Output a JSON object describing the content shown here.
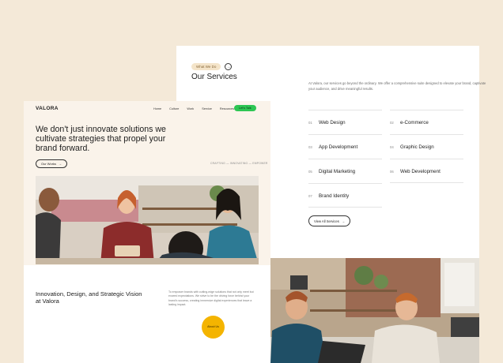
{
  "services": {
    "badge": "What We Do",
    "title": "Our Services",
    "description": "At Valora, our services go beyond the ordinary. We offer a comprehensive suite designed to elevate your brand, captivate your audience, and drive meaningful results.",
    "items": [
      {
        "num": "01",
        "label": "Web Design"
      },
      {
        "num": "02",
        "label": "e-Commerce"
      },
      {
        "num": "03",
        "label": "App Development"
      },
      {
        "num": "04",
        "label": "Graphic Design"
      },
      {
        "num": "05",
        "label": "Digital Marketing"
      },
      {
        "num": "06",
        "label": "Web Development"
      },
      {
        "num": "07",
        "label": "Brand Identity"
      }
    ],
    "view_all": "View All Services"
  },
  "home": {
    "logo": "VALORA",
    "nav": [
      "Home",
      "Culture",
      "Work",
      "Service",
      "Resources"
    ],
    "cta": "Let's Talk",
    "hero_title": "We don't just innovate solutions we cultivate strategies that propel your brand forward.",
    "our_story": "Our Works",
    "process": "CRAFTING — INNOVATING — EMPOWER",
    "about_title": "Innovation, Design, and Strategic Vision at Valora",
    "about_desc": "To empower brands with cutting-edge solutions that not only meet but exceed expectations. We strive to be the driving force behind your brand's success, creating immersive digital experiences that leave a lasting impact.",
    "about_btn": "About Us"
  },
  "colors": {
    "background": "#f4e9d8",
    "cta_green": "#2dc653",
    "accent_yellow": "#f4b400",
    "badge_bg": "#f4e4c9"
  }
}
